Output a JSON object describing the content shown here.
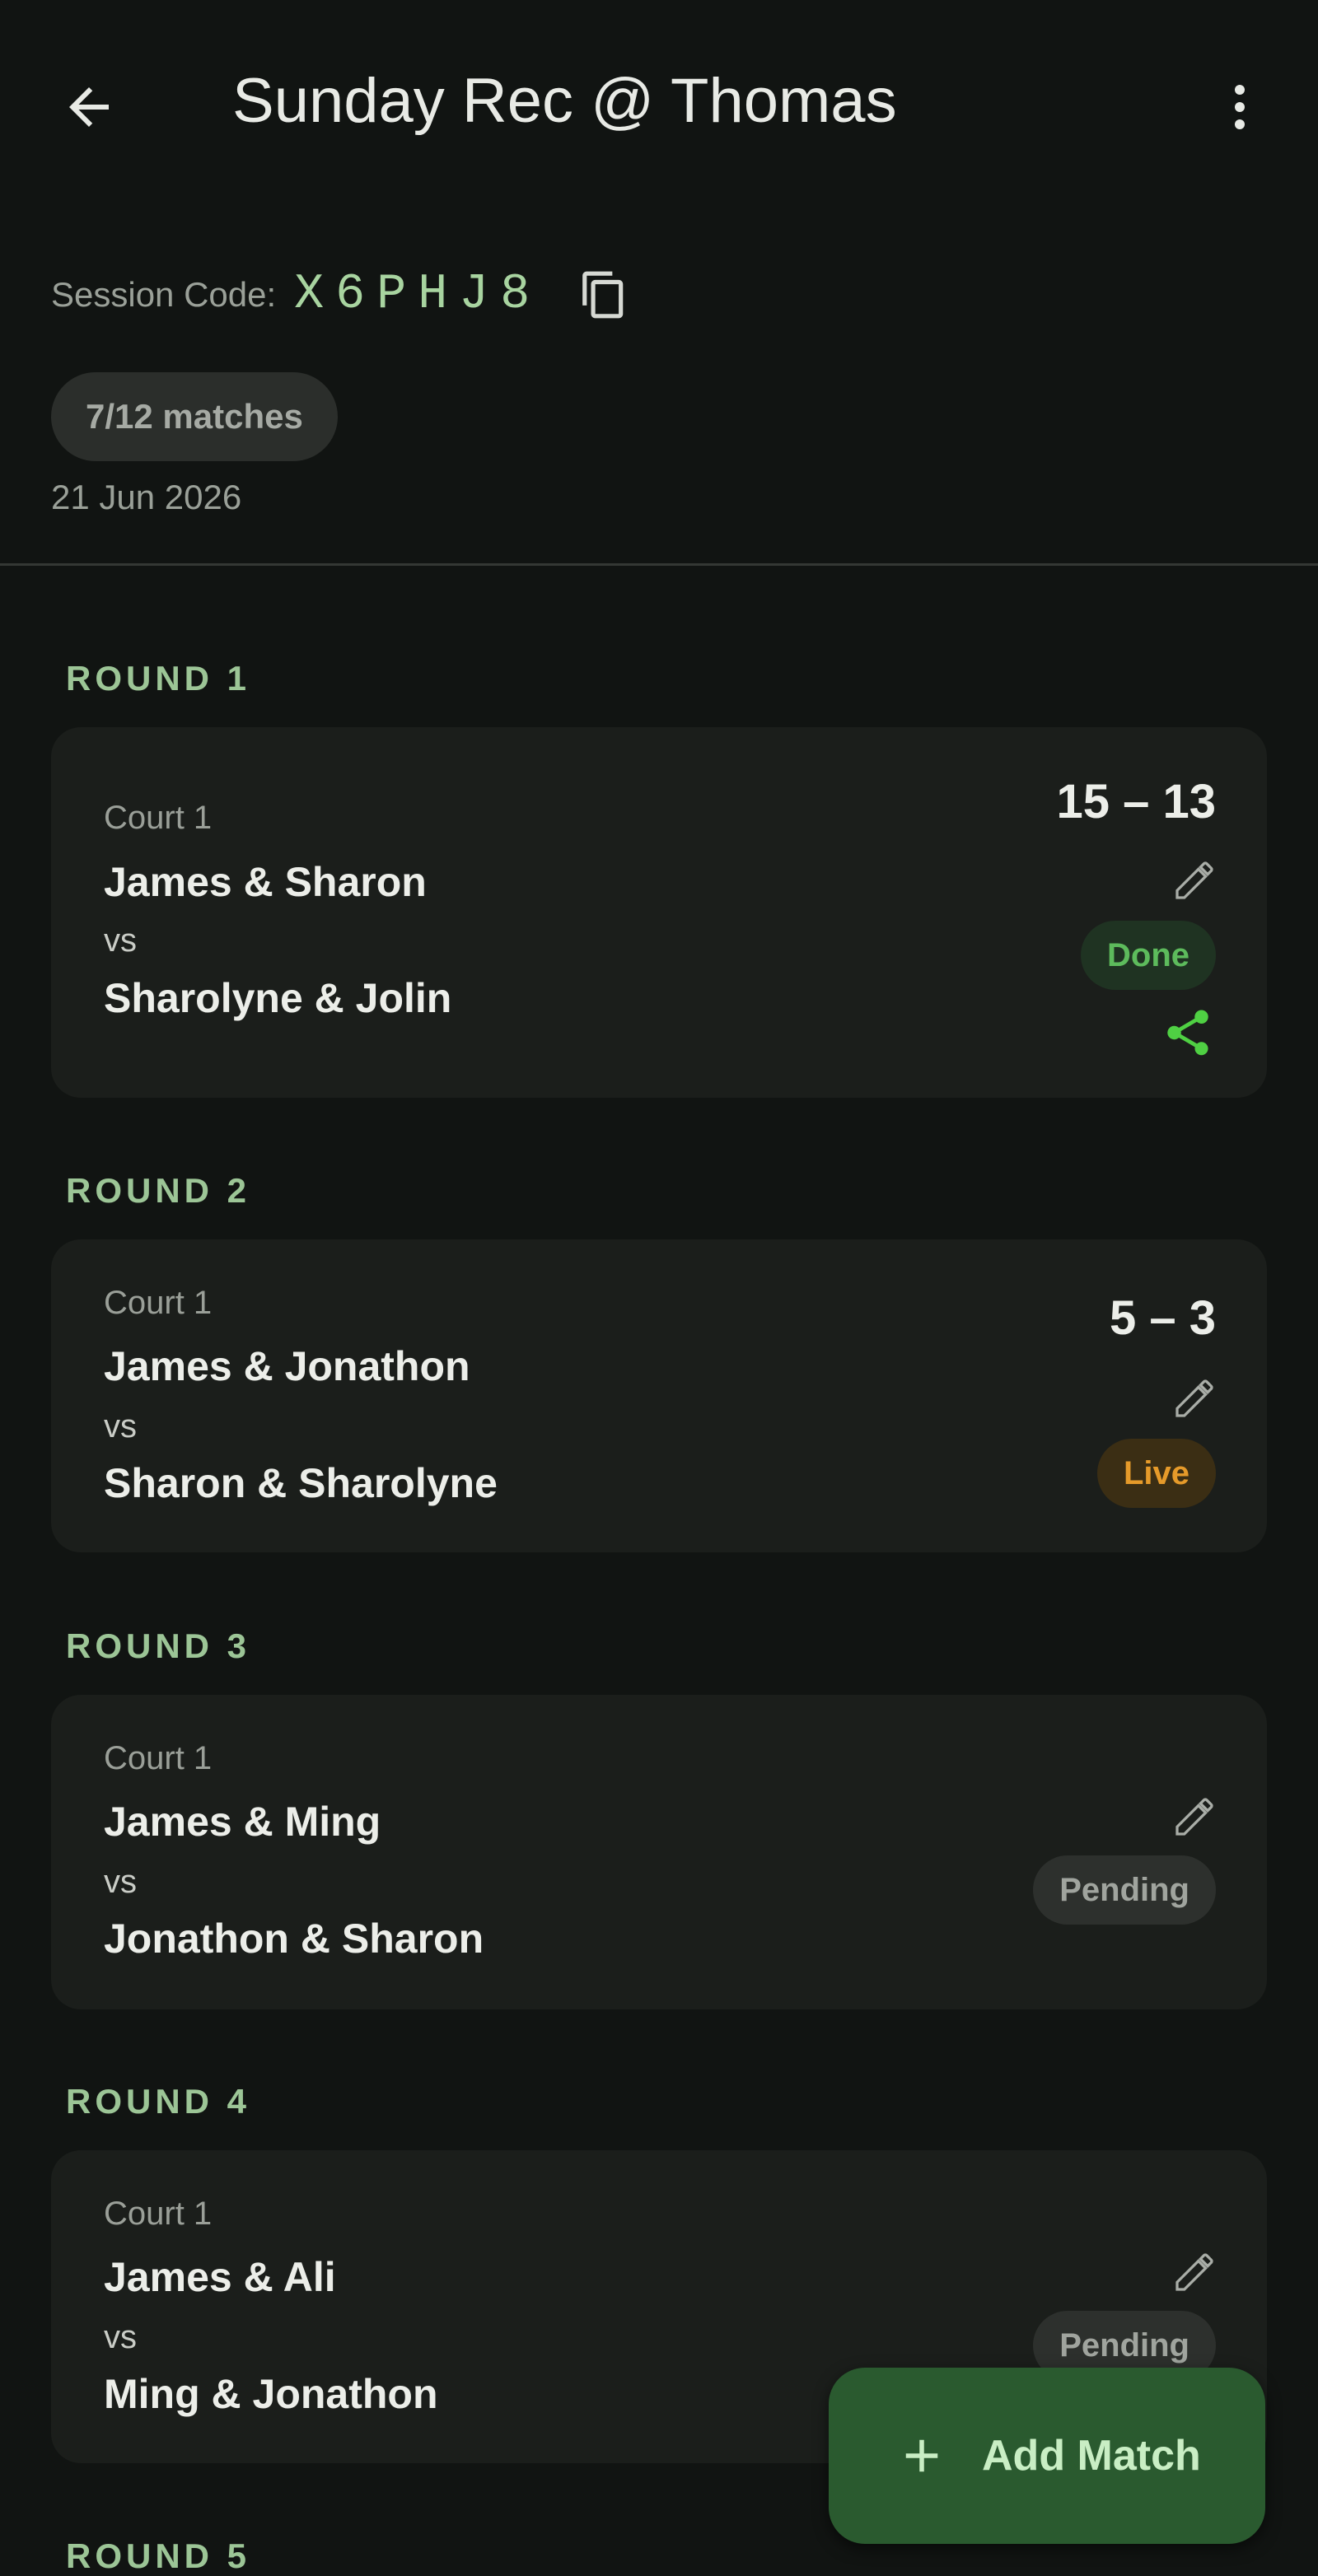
{
  "header": {
    "title": "Sunday Rec @ Thomas",
    "back_icon": "arrow-left-icon",
    "more_icon": "more-vert-icon"
  },
  "session": {
    "code_label": "Session Code:",
    "code": "X6PHJ8",
    "copy_icon": "copy-icon",
    "match_progress": "7/12 matches",
    "date": "21 Jun 2026"
  },
  "rounds": [
    {
      "heading": "ROUND 1",
      "court": "Court 1",
      "team_a": "James & Sharon",
      "vs": "vs",
      "team_b": "Sharolyne & Jolin",
      "score": "15 – 13",
      "status": "Done"
    },
    {
      "heading": "ROUND 2",
      "court": "Court 1",
      "team_a": "James & Jonathon",
      "vs": "vs",
      "team_b": "Sharon & Sharolyne",
      "score": "5 – 3",
      "status": "Live"
    },
    {
      "heading": "ROUND 3",
      "court": "Court 1",
      "team_a": "James & Ming",
      "vs": "vs",
      "team_b": "Jonathon & Sharon",
      "status": "Pending"
    },
    {
      "heading": "ROUND 4",
      "court": "Court 1",
      "team_a": "James & Ali",
      "vs": "vs",
      "team_b": "Ming & Jonathon",
      "status": "Pending"
    },
    {
      "heading": "ROUND 5"
    }
  ],
  "fab": {
    "label": "Add Match",
    "icon": "plus-icon"
  },
  "colors": {
    "background": "#111412",
    "card": "#1b1e1b",
    "accent_green": "#a8d4a0",
    "round_heading": "#9cc596",
    "status_done": "#5dbb5c",
    "status_live": "#e59a2a",
    "status_pending": "#a0a49e",
    "share_icon": "#4fd043",
    "fab_background": "#2a5a2f"
  }
}
